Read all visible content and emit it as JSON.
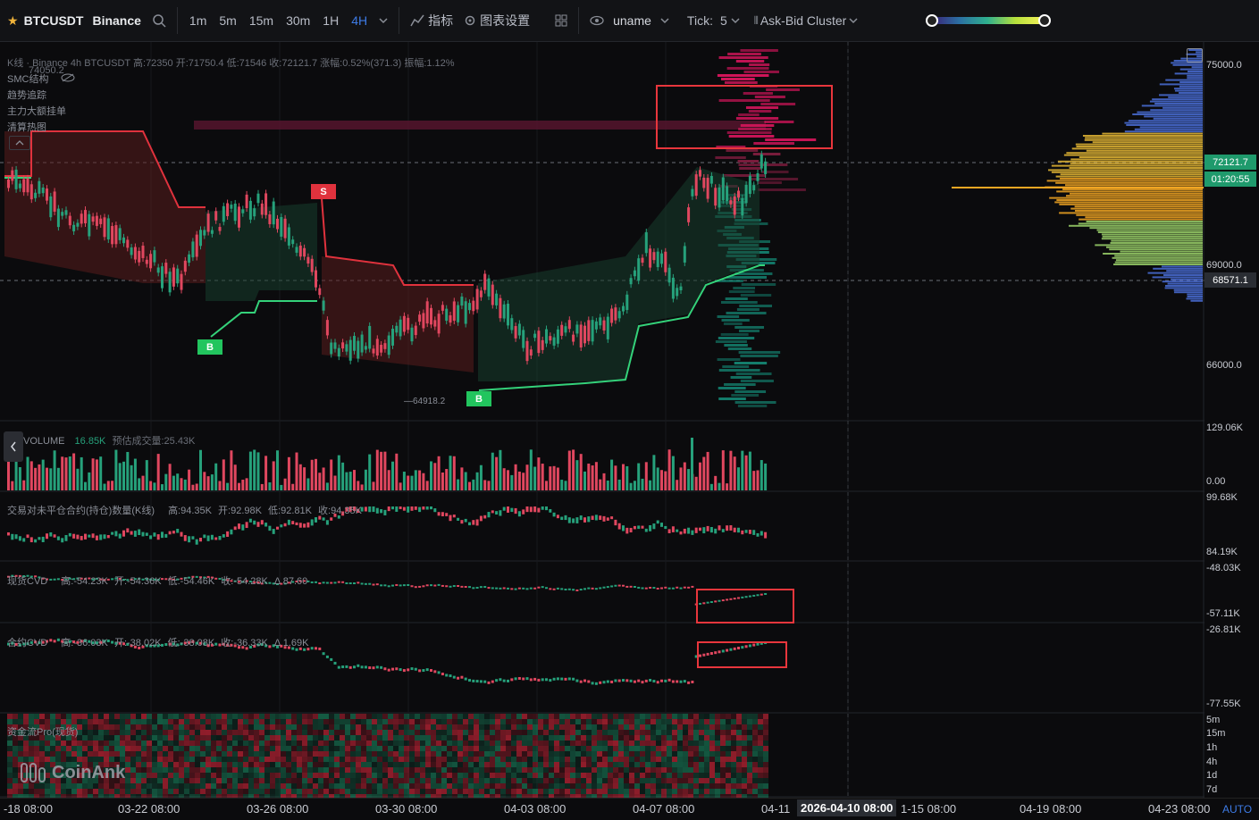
{
  "toolbar": {
    "symbol": "BTCUSDT",
    "exchange": "Binance",
    "timeframes": [
      "1m",
      "5m",
      "15m",
      "30m",
      "1H",
      "4H"
    ],
    "active_timeframe": "4H",
    "indicators_label": "指标",
    "chart_settings_label": "图表设置",
    "user_label": "uname",
    "tick_label": "Tick:",
    "tick_value": "5",
    "cluster_label": "Ask-Bid Cluster"
  },
  "legend": {
    "kline_info": "K线 · Binance 4h BTCUSDT 高:72350 开:71750.4 低:71546 收:72121.7 涨幅:0.52%(371.3) 振幅:1.12%",
    "high_marker": "74050.2",
    "smc_label": "SMC结构",
    "trend_label": "趋势追踪",
    "big_order_label": "主力大额挂单",
    "liquidation_label": "清算热图"
  },
  "price_axis": [
    "75000.0",
    "72121.7",
    "01:20:55",
    "69000.0",
    "68571.1",
    "66000.0"
  ],
  "low_marker": "64918.2",
  "signals": [
    "S",
    "B",
    "B"
  ],
  "volume_pane": {
    "label": "VOLUME",
    "value": "16.85K",
    "estimate": "预估成交量:25.43K",
    "axis": [
      "129.06K",
      "0.00"
    ]
  },
  "oi_pane": {
    "label": "交易对未平仓合约(持仓)数量(K线)",
    "high": "高:94.35K",
    "open": "开:92.98K",
    "low": "低:92.81K",
    "close": "收:94.35K",
    "axis": [
      "99.68K",
      "84.19K"
    ]
  },
  "spot_cvd_pane": {
    "label": "现货CVD",
    "high": "高:-54.23K",
    "open": "开:-54.36K",
    "low": "低:-54.46K",
    "close": "收:-54.28K",
    "delta": "Δ 87.60",
    "axis": [
      "-48.03K",
      "-57.11K"
    ]
  },
  "futures_cvd_pane": {
    "label": "合约CVD",
    "high": "高:-36.03K",
    "open": "开:-38.02K",
    "low": "低:-38.08K",
    "close": "收:-36.33K",
    "delta": "Δ 1.69K",
    "axis": [
      "-26.81K",
      "-77.55K"
    ]
  },
  "flow_pane": {
    "label": "资金流Pro(现货)",
    "timeframes": [
      "5m",
      "15m",
      "1h",
      "4h",
      "1d",
      "7d"
    ],
    "watermark": "CoinAnk"
  },
  "time_axis": {
    "ticks": [
      "-18 08:00",
      "03-22 08:00",
      "03-26 08:00",
      "03-30 08:00",
      "04-03 08:00",
      "04-07 08:00",
      "04-11",
      "1-15 08:00",
      "04-19 08:00",
      "04-23 08:00"
    ],
    "crosshair": "2026-04-10 08:00",
    "auto": "AUTO"
  },
  "colors": {
    "up": "#26a17b",
    "down": "#e0475f",
    "accent": "#3d7be6",
    "highlight_box": "#e8363c"
  }
}
